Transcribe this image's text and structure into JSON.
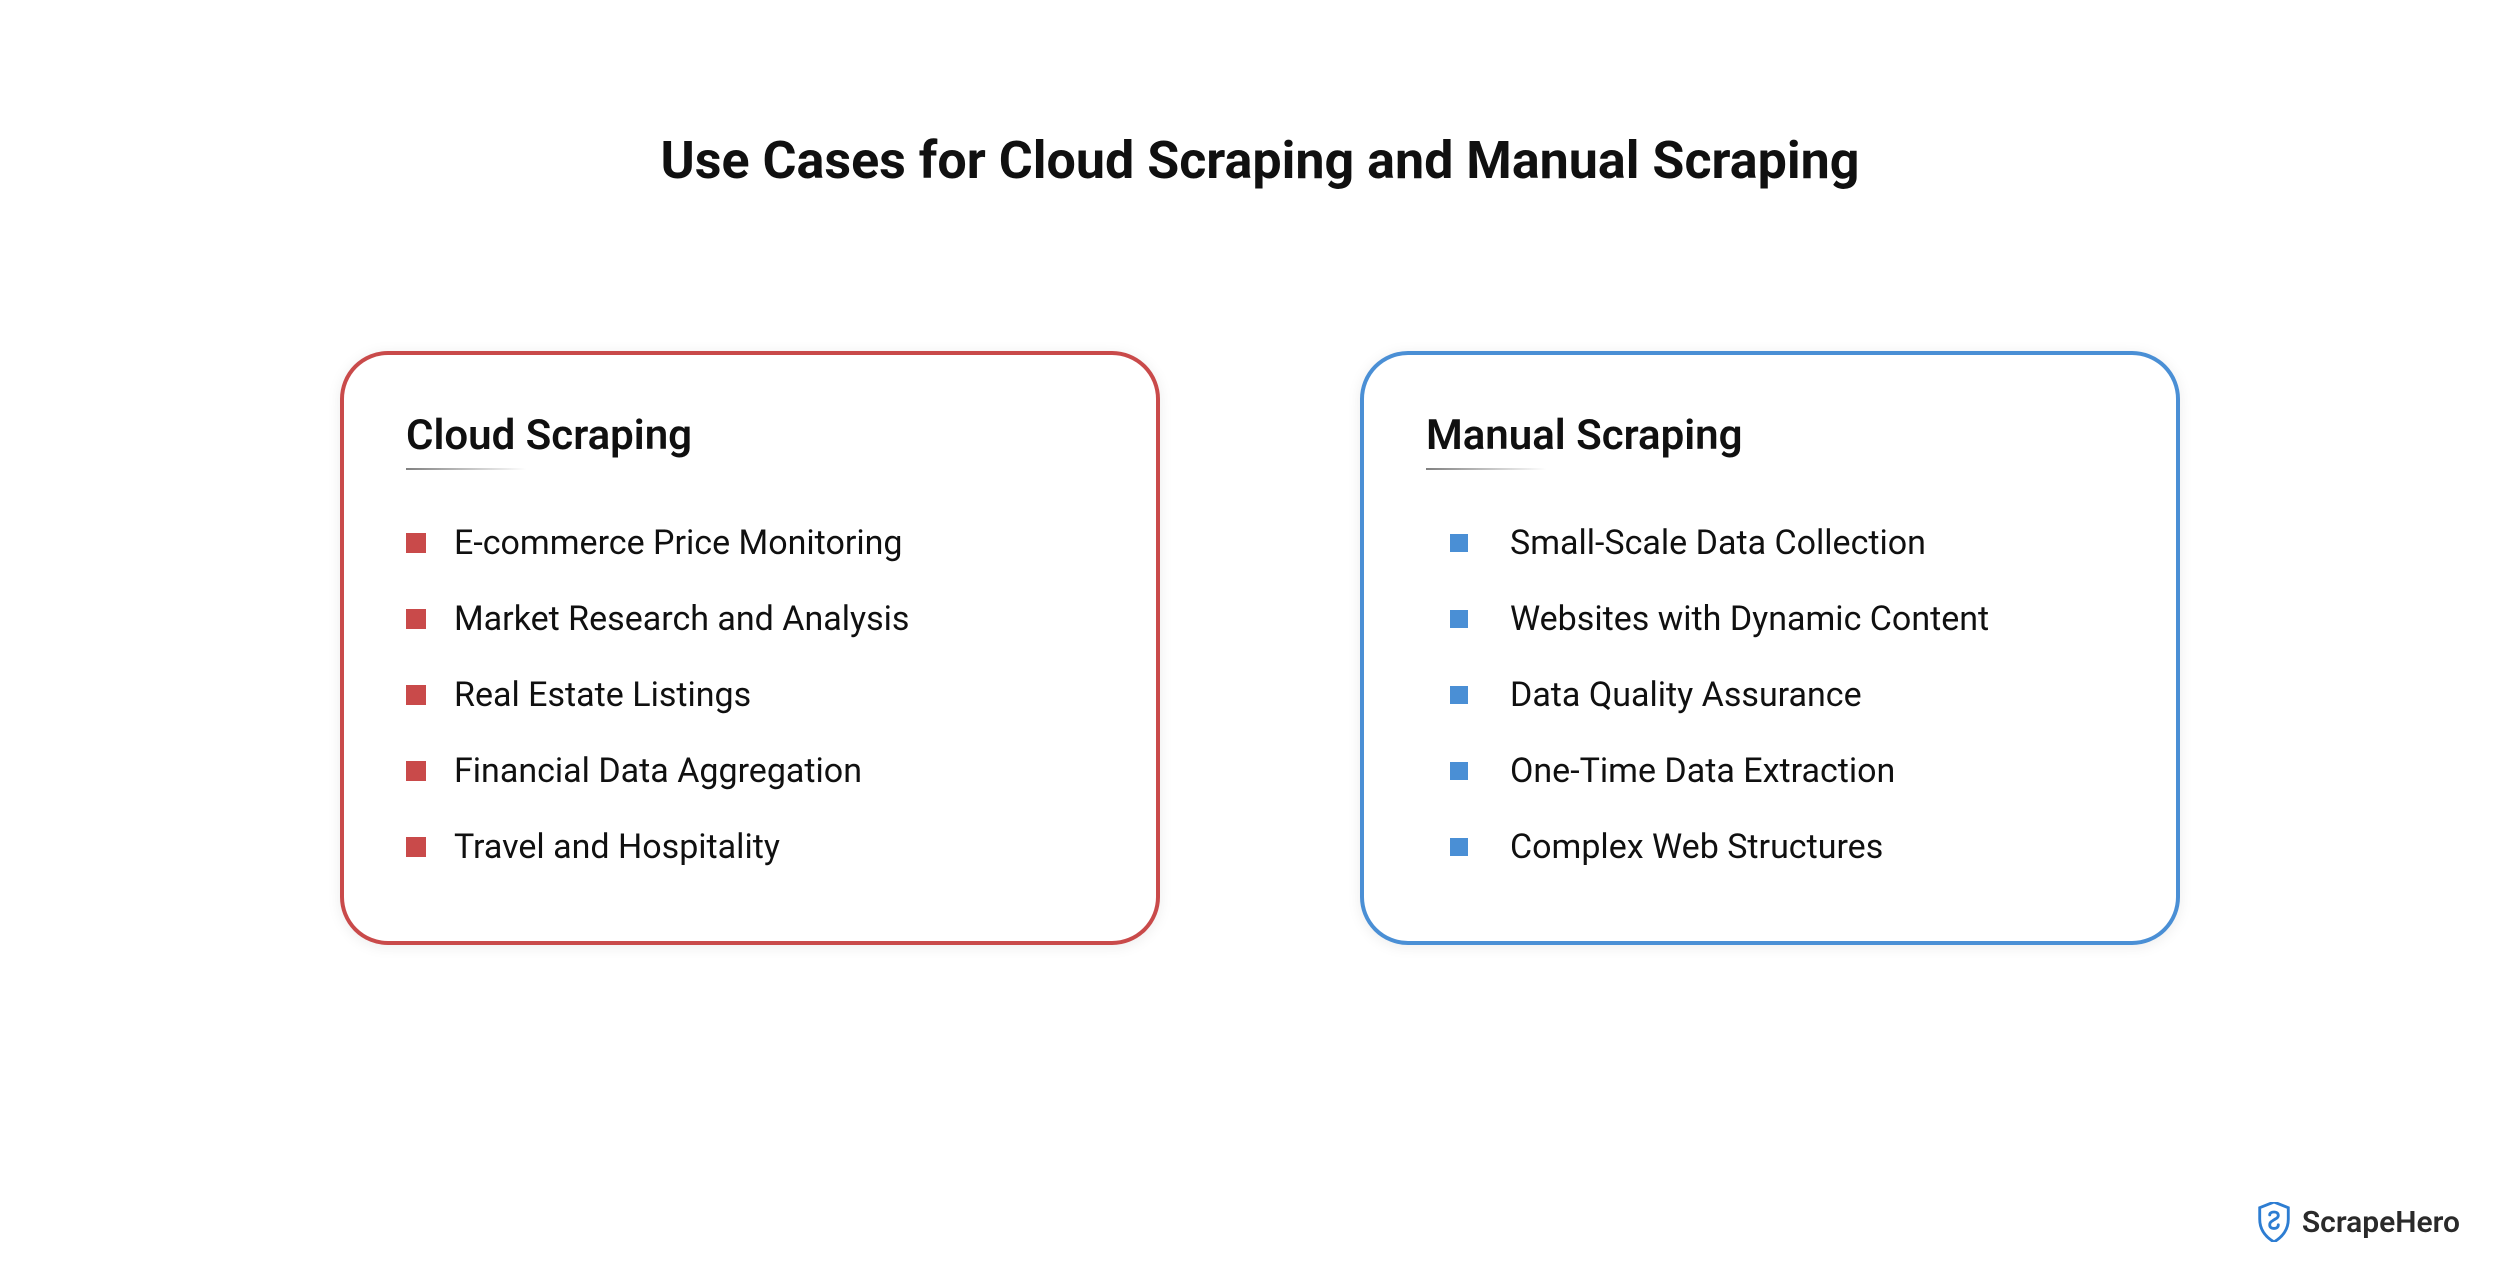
{
  "title": "Use Cases for Cloud Scraping and Manual Scraping",
  "cards": [
    {
      "heading": "Cloud Scraping",
      "items": [
        "E-commerce Price Monitoring",
        "Market Research and Analysis",
        "Real Estate Listings",
        "Financial Data Aggregation",
        "Travel and Hospitality"
      ]
    },
    {
      "heading": "Manual Scraping",
      "items": [
        "Small-Scale Data Collection",
        "Websites with Dynamic Content",
        "Data Quality Assurance",
        "One-Time Data Extraction",
        "Complex Web Structures"
      ]
    }
  ],
  "logo": {
    "text": "ScrapeHero"
  },
  "colors": {
    "red": "#c94a4a",
    "blue": "#4a8fd5"
  }
}
